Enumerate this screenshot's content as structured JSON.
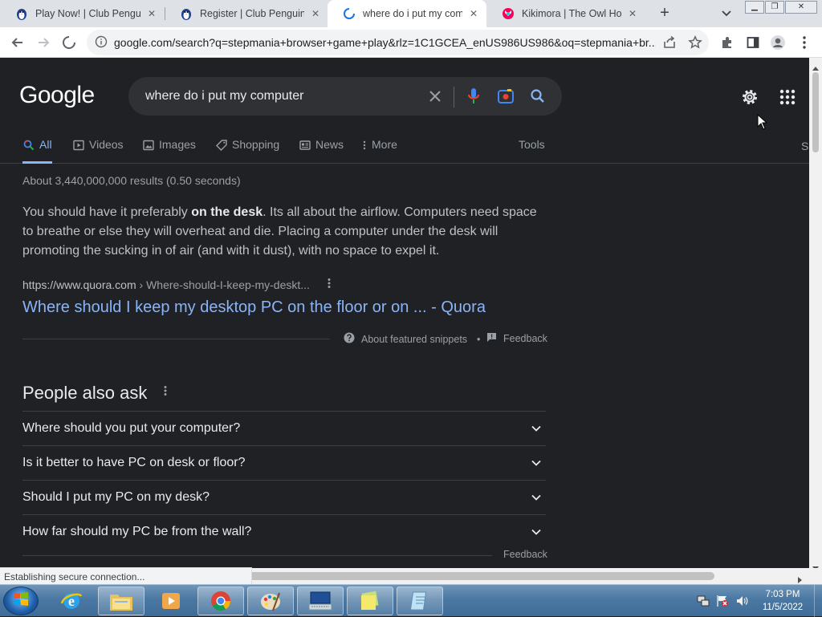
{
  "browser": {
    "tabs": [
      {
        "title": "Play Now! | Club Penguin",
        "favicon": "penguin-icon",
        "active": false
      },
      {
        "title": "Register | Club Penguin Le",
        "favicon": "penguin-icon",
        "active": false
      },
      {
        "title": "where do i put my compu",
        "favicon": "loading-spinner-icon",
        "active": true
      },
      {
        "title": "Kikimora | The Owl House",
        "favicon": "fandom-icon",
        "active": false
      }
    ],
    "url": "google.com/search?q=stepmania+browser+game+play&rlz=1C1GCEA_enUS986US986&oq=stepmania+br...",
    "status_text": "Establishing secure connection..."
  },
  "google": {
    "logo_text": "Google",
    "query": "where do i put my computer",
    "nav_tabs": [
      {
        "label": "All",
        "icon": "search-icon",
        "active": true
      },
      {
        "label": "Videos",
        "icon": "video-icon",
        "active": false
      },
      {
        "label": "Images",
        "icon": "image-icon",
        "active": false
      },
      {
        "label": "Shopping",
        "icon": "tag-icon",
        "active": false
      },
      {
        "label": "News",
        "icon": "news-icon",
        "active": false
      },
      {
        "label": "More",
        "icon": "more-vertical-icon",
        "active": false
      }
    ],
    "tools_label": "Tools",
    "edge_text": "S",
    "result_stats": "About 3,440,000,000 results (0.50 seconds)",
    "featured_snippet": {
      "text_before": "You should have it preferably ",
      "bold": "on the desk",
      "text_after": ". Its all about the airflow. Computers need space to breathe or else they will overheat and die. Placing a computer under the desk will promoting the sucking in of air (and with it dust), with no space to expel it.",
      "cite_domain": "https://www.quora.com",
      "cite_path": " › Where-should-I-keep-my-deskt...",
      "link_title": "Where should I keep my desktop PC on the floor or on ... - Quora",
      "about_label": "About featured snippets",
      "separator": "•",
      "feedback_label": "Feedback"
    },
    "people_also_ask": {
      "title": "People also ask",
      "questions": [
        "Where should you put your computer?",
        "Is it better to have PC on desk or floor?",
        "Should I put my PC on my desk?",
        "How far should my PC be from the wall?"
      ],
      "feedback_label": "Feedback"
    }
  },
  "taskbar": {
    "clock_time": "7:03 PM",
    "clock_date": "11/5/2022",
    "apps": [
      "internet-explorer-icon",
      "file-explorer-icon",
      "media-player-icon",
      "chrome-icon",
      "paint-icon",
      "keyboard-app-icon",
      "sticky-notes-icon",
      "notepad-icon"
    ]
  },
  "colors": {
    "page_bg": "#202124",
    "link": "#8ab4f8",
    "text": "#e8eaed",
    "muted": "#9aa0a6"
  }
}
